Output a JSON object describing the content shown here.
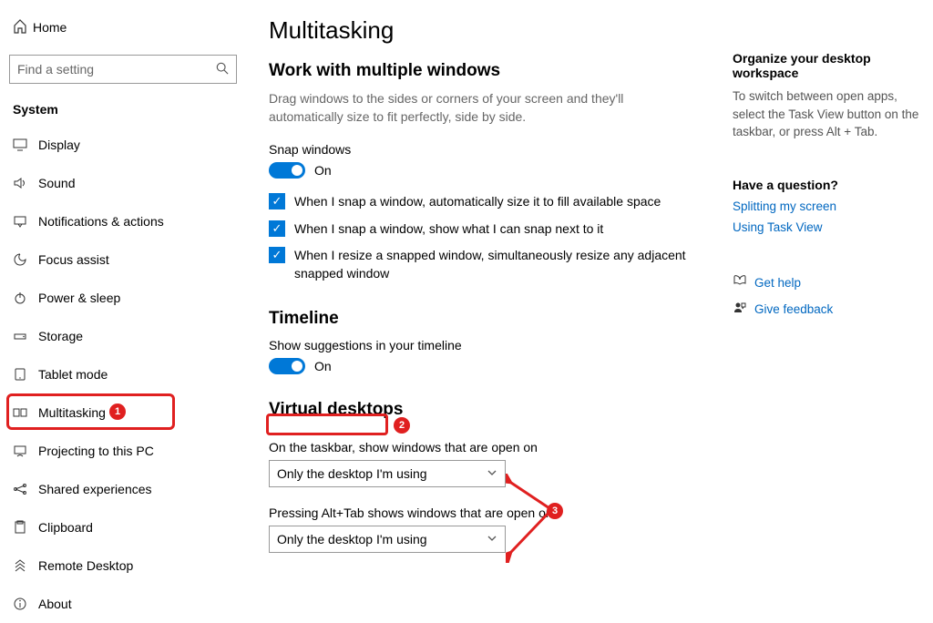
{
  "sidebar": {
    "home": "Home",
    "search_placeholder": "Find a setting",
    "section": "System",
    "items": [
      {
        "label": "Display"
      },
      {
        "label": "Sound"
      },
      {
        "label": "Notifications & actions"
      },
      {
        "label": "Focus assist"
      },
      {
        "label": "Power & sleep"
      },
      {
        "label": "Storage"
      },
      {
        "label": "Tablet mode"
      },
      {
        "label": "Multitasking"
      },
      {
        "label": "Projecting to this PC"
      },
      {
        "label": "Shared experiences"
      },
      {
        "label": "Clipboard"
      },
      {
        "label": "Remote Desktop"
      },
      {
        "label": "About"
      }
    ]
  },
  "main": {
    "title": "Multitasking",
    "section1": {
      "heading": "Work with multiple windows",
      "desc": "Drag windows to the sides or corners of your screen and they'll automatically size to fit perfectly, side by side.",
      "snap_label": "Snap windows",
      "snap_state": "On",
      "check1": "When I snap a window, automatically size it to fill available space",
      "check2": "When I snap a window, show what I can snap next to it",
      "check3": "When I resize a snapped window, simultaneously resize any adjacent snapped window"
    },
    "section2": {
      "heading": "Timeline",
      "label": "Show suggestions in your timeline",
      "state": "On"
    },
    "section3": {
      "heading": "Virtual desktops",
      "label1": "On the taskbar, show windows that are open on",
      "value1": "Only the desktop I'm using",
      "label2": "Pressing Alt+Tab shows windows that are open on",
      "value2": "Only the desktop I'm using"
    }
  },
  "aside": {
    "heading1": "Organize your desktop workspace",
    "text1": "To switch between open apps, select the Task View button on the taskbar, or press Alt + Tab.",
    "heading2": "Have a question?",
    "link1": "Splitting my screen",
    "link2": "Using Task View",
    "help": "Get help",
    "feedback": "Give feedback"
  },
  "annotations": {
    "b1": "1",
    "b2": "2",
    "b3": "3"
  }
}
